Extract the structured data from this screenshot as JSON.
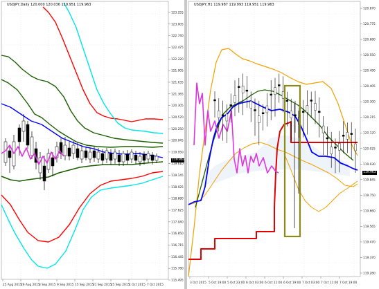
{
  "left": {
    "header": {
      "symbol": "USDJPY,Daily",
      "ohlc": "120.000 120.036 119.951 119.963"
    },
    "price_labels": [
      "123.255",
      "123.005",
      "122.740",
      "122.475",
      "122.220",
      "121.905",
      "121.635",
      "121.365",
      "120.305",
      "120.570",
      "120.250",
      "120.045",
      "119.950",
      "119.610",
      "119.145",
      "118.925",
      "118.680",
      "117.625",
      "117.040",
      "116.850",
      "116.715",
      "116.445",
      "115.780",
      "115.495"
    ],
    "current_price": "119.963",
    "time_labels": [
      "25 Aug 2015",
      "29 Aug 2015",
      "3 Sep 2015",
      "9 Sep 2015",
      "15 Sep 2015",
      "21 Sep 2015",
      "25 Sep 2015",
      "1 Oct 2015",
      "7 Oct 2015"
    ],
    "colors": {
      "upper3": "#ff0000",
      "upper2": "#00e5e5",
      "upper1": "#1a5c00",
      "ma": "#0000ff",
      "lower1": "#1a5c00",
      "lower2": "#ff0000",
      "lower3": "#00e5e5",
      "lagging": "#e033e0"
    }
  },
  "right": {
    "header": {
      "symbol": "USDJPY,H1",
      "ohlc": "119.987 119.993 119.951 119.963"
    },
    "price_labels": [
      "120.870",
      "120.775",
      "120.680",
      "120.550",
      "120.490",
      "120.405",
      "120.300",
      "120.215",
      "120.120",
      "120.025",
      "119.930",
      "119.845",
      "119.750",
      "119.660",
      "119.565",
      "119.470",
      "119.370",
      "119.280"
    ],
    "current_price": "119.963",
    "time_labels": [
      "3 Oct 2015",
      "5 Oct 19:00",
      "5 Oct 23:00",
      "6 Oct 03:00",
      "6 Oct 11:00",
      "6 Oct 19:00",
      "7 Oct 03:00",
      "7 Oct 11:00",
      "7 Oct 19:00"
    ],
    "highlight_color": "#8a8a1a",
    "colors": {
      "band": "#f0a000",
      "ma": "#0000ff",
      "ema": "#1a5c00",
      "red": "#e00000",
      "lagging": "#e033e0"
    }
  }
}
